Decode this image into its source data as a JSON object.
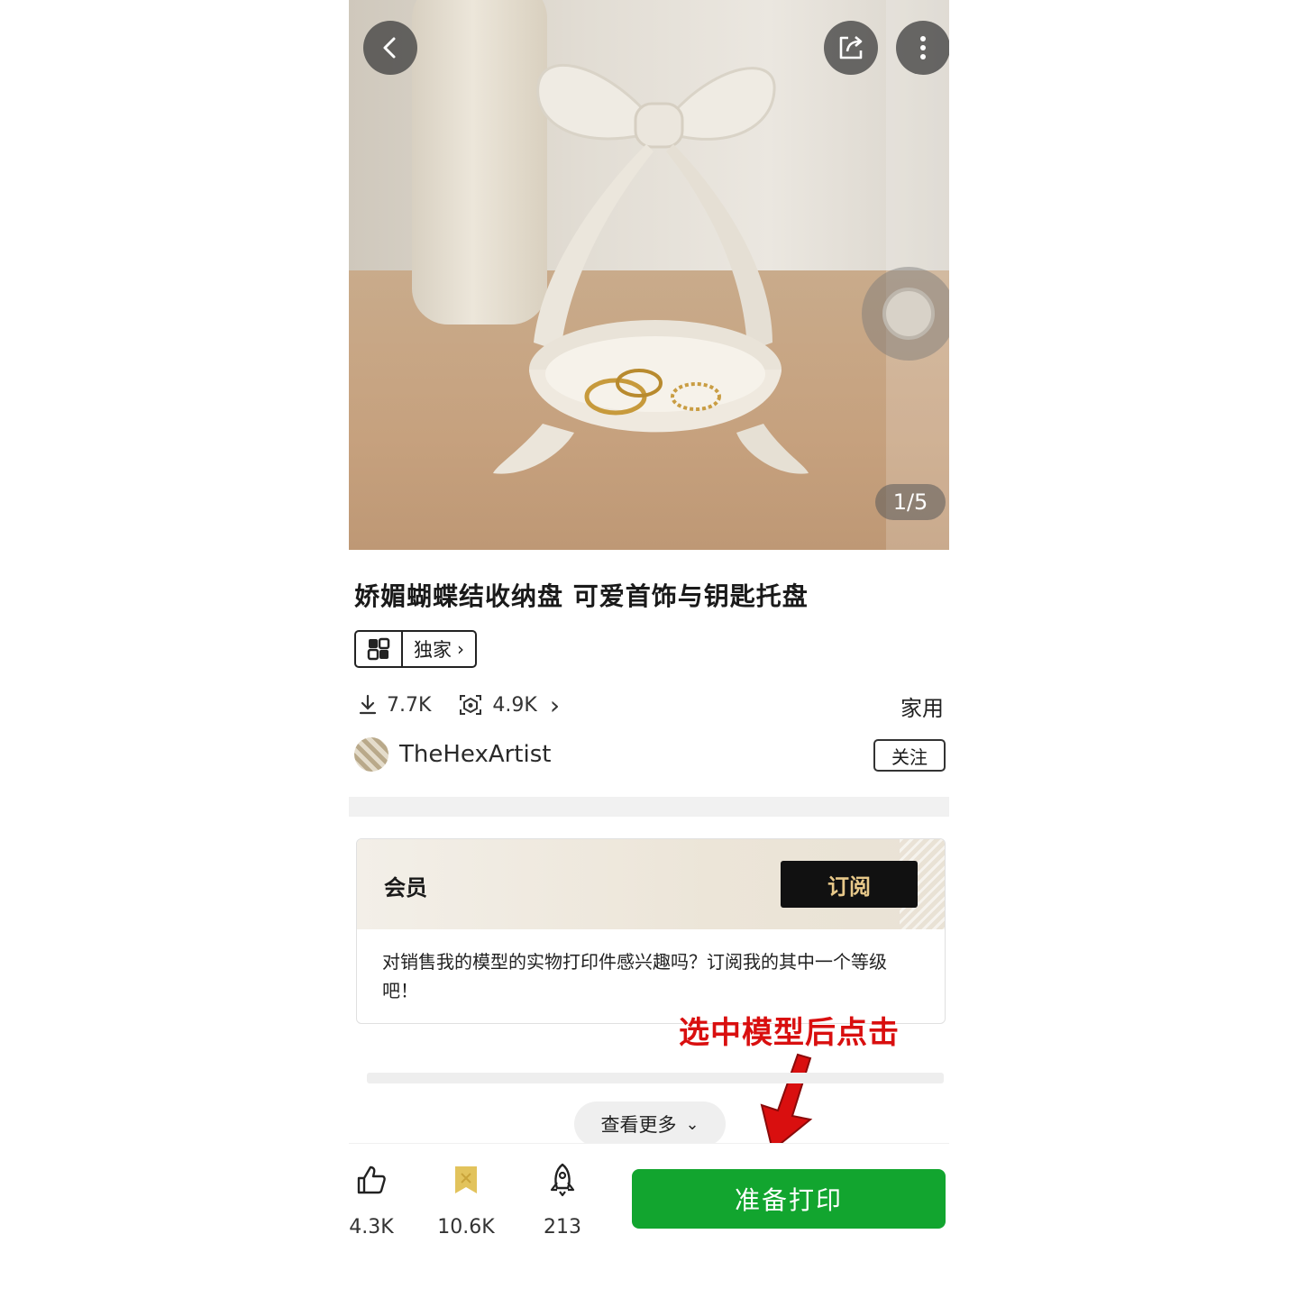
{
  "gallery": {
    "pager": "1/5"
  },
  "model": {
    "title": "娇媚蝴蝶结收纳盘 可爱首饰与钥匙托盘",
    "badge": "独家",
    "downloads": "7.7K",
    "prints": "4.9K",
    "category": "家用"
  },
  "author": {
    "name": "TheHexArtist",
    "follow_label": "关注"
  },
  "membership": {
    "label": "会员",
    "subscribe_label": "订阅",
    "description": "对销售我的模型的实物打印件感兴趣吗？订阅我的其中一个等级吧！"
  },
  "annotation": {
    "text": "选中模型后点击",
    "color": "#d90f0f"
  },
  "see_more": {
    "label": "查看更多"
  },
  "bottom_bar": {
    "likes": "4.3K",
    "favorites": "10.6K",
    "boosts": "213",
    "print_label": "准备打印",
    "print_color": "#12a52f"
  },
  "icons": [
    "back-icon",
    "share-icon",
    "more-icon",
    "download-icon",
    "print-count-icon",
    "chevron-right-icon",
    "like-icon",
    "favorite-icon",
    "boost-icon",
    "chevron-down-icon"
  ]
}
